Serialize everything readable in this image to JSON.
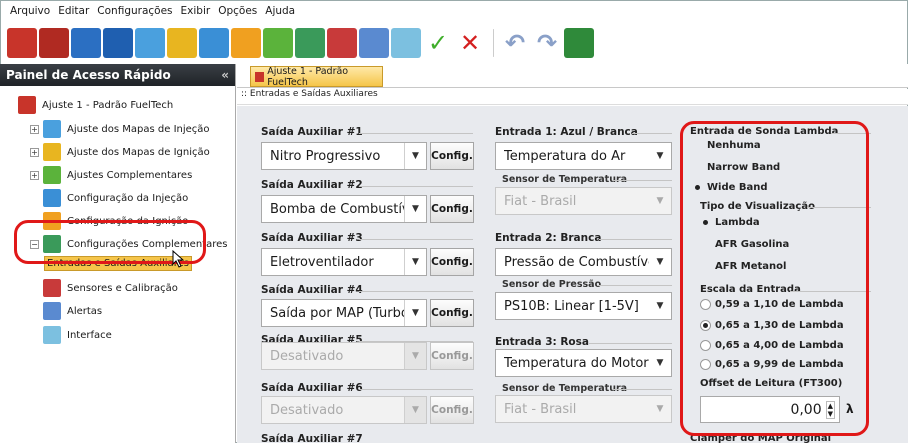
{
  "menu": [
    "Arquivo",
    "Editar",
    "Configurações",
    "Exibir",
    "Opções",
    "Ajuda"
  ],
  "toolbar": {
    "check": "✓",
    "close": "✕",
    "undo": "↶",
    "redo": "↷"
  },
  "left_panel": {
    "title": "Painel de Acesso Rápido",
    "pin": "« ",
    "items": [
      {
        "label": "Ajuste 1 - Padrão FuelTech",
        "icon": "fueltech-icon"
      },
      {
        "label": "Ajuste dos Mapas de Injeção",
        "icon": "injection-map-icon"
      },
      {
        "label": "Ajuste dos Mapas de Ignição",
        "icon": "ignition-map-icon"
      },
      {
        "label": "Ajustes Complementares",
        "icon": "complementary-adjust-icon"
      },
      {
        "label": "Configuração da Injeção",
        "icon": "injection-config-icon"
      },
      {
        "label": "Configuração da Ignição",
        "icon": "ignition-config-icon"
      },
      {
        "label": "Configurações Complementares",
        "icon": "complementary-config-icon"
      },
      {
        "label": "Entradas e Saídas Auxiliares",
        "icon": ""
      },
      {
        "label": "Sensores e Calibração",
        "icon": "sensors-icon"
      },
      {
        "label": "Alertas",
        "icon": "alerts-icon"
      },
      {
        "label": "Interface",
        "icon": "interface-icon"
      }
    ]
  },
  "tab": {
    "label": "Ajuste 1 - Padrão FuelTech"
  },
  "breadcrumb": ":: Entradas e Saídas Auxiliares",
  "outputs": [
    {
      "label": "Saída Auxiliar #1",
      "value": "Nitro Progressivo",
      "button": "Config."
    },
    {
      "label": "Saída Auxiliar #2",
      "value": "Bomba de Combustível",
      "button": "Config."
    },
    {
      "label": "Saída Auxiliar #3",
      "value": "Eletroventilador",
      "button": "Config."
    },
    {
      "label": "Saída Auxiliar #4",
      "value": "Saída por MAP (Turbo)",
      "button": "Config."
    },
    {
      "label": "Saída Auxiliar #5",
      "value": "Desativado",
      "button": "Config."
    },
    {
      "label": "Saída Auxiliar #6",
      "value": "Desativado",
      "button": "Config."
    },
    {
      "label": "Saída Auxiliar #7"
    }
  ],
  "inputs": [
    {
      "label": "Entrada 1: Azul / Branca",
      "value": "Temperatura do Ar",
      "sensor_label": "Sensor de Temperatura",
      "sensor_value": "Fiat - Brasil"
    },
    {
      "label": "Entrada 2: Branca",
      "value": "Pressão de Combustível",
      "sensor_label": "Sensor de Pressão",
      "sensor_value": "PS10B: Linear [1-5V]"
    },
    {
      "label": "Entrada 3: Rosa",
      "value": "Temperatura do Motor",
      "sensor_label": "Sensor de Temperatura",
      "sensor_value": "Fiat - Brasil"
    }
  ],
  "lambda": {
    "title": "Entrada de Sonda Lambda",
    "options": [
      "Nenhuma",
      "Narrow Band",
      "Wide Band"
    ],
    "selected": 2,
    "view_title": "Tipo de Visualização",
    "view_options": [
      "Lambda",
      "AFR Gasolina",
      "AFR Metanol"
    ],
    "view_selected": 0,
    "scale_title": "Escala da Entrada",
    "scale_options": [
      "0,59 a 1,10 de Lambda",
      "0,65 a 1,30 de Lambda",
      "0,65 a 4,00 de Lambda",
      "0,65 a 9,99 de Lambda"
    ],
    "scale_selected": 1,
    "offset_title": "Offset de Leitura (FT300)",
    "offset_value": "0,00",
    "offset_unit": "λ",
    "next_title": "Clamper do MAP Original"
  },
  "colors": {
    "highlight": "#e01818",
    "selected_item": "#f5c54a"
  }
}
